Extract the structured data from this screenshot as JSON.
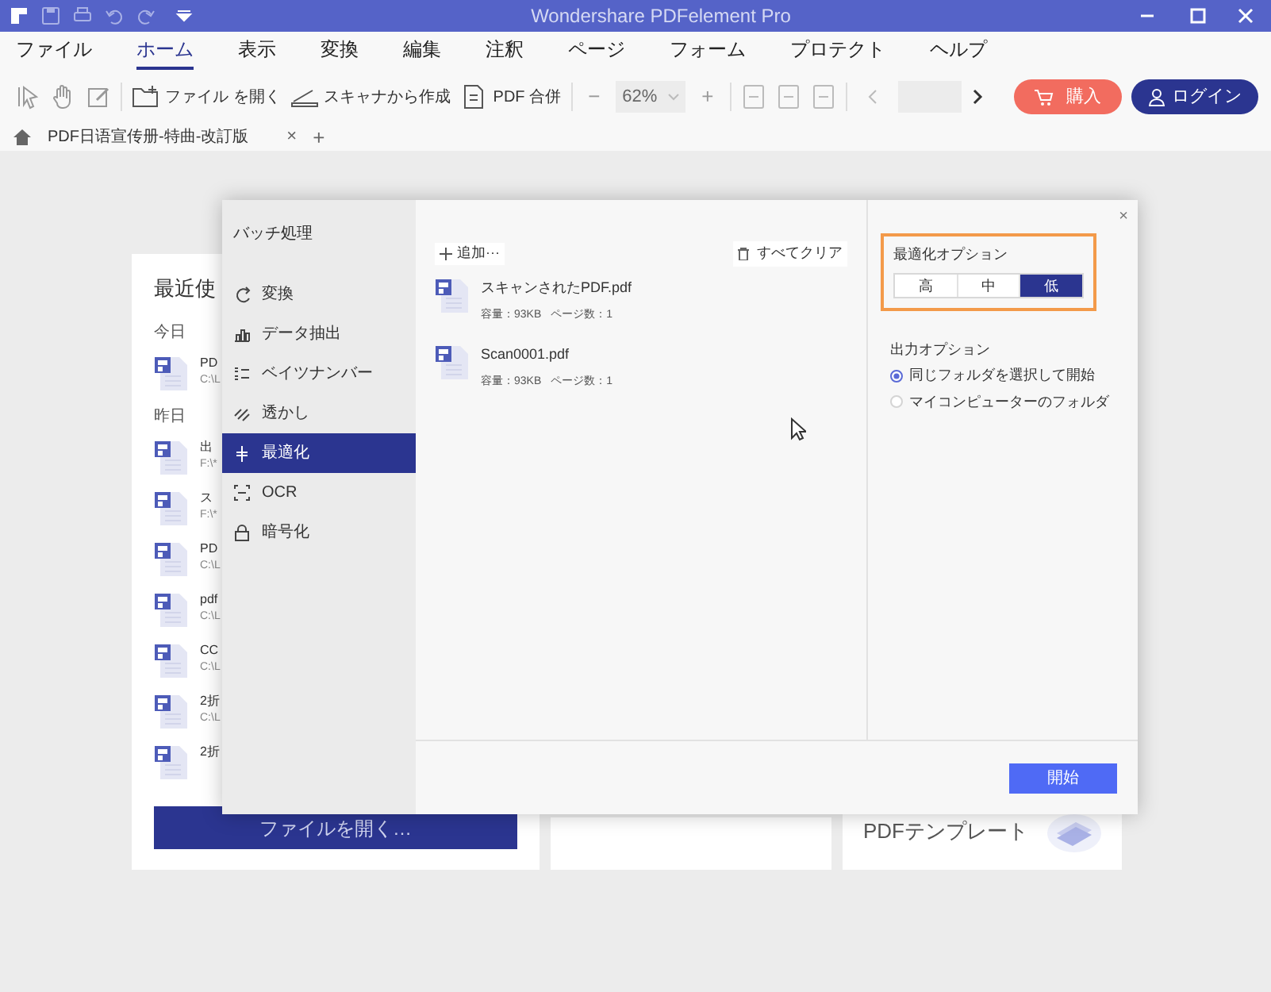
{
  "window": {
    "title": "Wondershare PDFelement Pro"
  },
  "menu": [
    {
      "label": "ファイル",
      "selected": false
    },
    {
      "label": "ホーム",
      "selected": true
    },
    {
      "label": "表示",
      "selected": false
    },
    {
      "label": "変換",
      "selected": false
    },
    {
      "label": "編集",
      "selected": false
    },
    {
      "label": "注釈",
      "selected": false
    },
    {
      "label": "ページ",
      "selected": false
    },
    {
      "label": "フォーム",
      "selected": false
    },
    {
      "label": "プロテクト",
      "selected": false
    },
    {
      "label": "ヘルプ",
      "selected": false
    }
  ],
  "toolbar": {
    "open_file": "ファイル を開く",
    "scan": "スキャナから作成",
    "merge": "PDF 合併",
    "zoom_out": "−",
    "zoom": "62%",
    "zoom_in": "+",
    "buy": "購入",
    "login": "ログイン"
  },
  "doc_tab": {
    "title": "PDF日语宣传册-特曲-改訂版",
    "close": "×",
    "add": "+"
  },
  "recent": {
    "title": "最近使",
    "groups": [
      {
        "label": "今日",
        "files": [
          {
            "name": "PD",
            "path": "C:\\L"
          }
        ]
      },
      {
        "label": "昨日",
        "files": [
          {
            "name": "出",
            "path": "F:\\*"
          },
          {
            "name": "ス",
            "path": "F:\\*"
          },
          {
            "name": "PD",
            "path": "C:\\L"
          },
          {
            "name": "pdf",
            "path": "C:\\L"
          },
          {
            "name": "CC",
            "path": "C:\\L"
          },
          {
            "name": "2折",
            "path": "C:\\L"
          },
          {
            "name": "2折"
          }
        ]
      }
    ],
    "open_button": "ファイルを開く…"
  },
  "template_card": {
    "title": "PDFテンプレート"
  },
  "dialog": {
    "title": "バッチ処理",
    "close": "×",
    "sidebar": [
      {
        "label": "変換",
        "kind": "convert",
        "selected": false
      },
      {
        "label": "データ抽出",
        "kind": "extract",
        "selected": false
      },
      {
        "label": "ベイツナンバー",
        "kind": "bates",
        "selected": false
      },
      {
        "label": "透かし",
        "kind": "watermark",
        "selected": false
      },
      {
        "label": "最適化",
        "kind": "optimize",
        "selected": true
      },
      {
        "label": "OCR",
        "kind": "ocr",
        "selected": false
      },
      {
        "label": "暗号化",
        "kind": "encrypt",
        "selected": false
      }
    ],
    "add": "追加···",
    "clear_all": "すべてクリア",
    "files": [
      {
        "name": "スキャンされたPDF.pdf",
        "size": "容量：93KB",
        "pages": "ページ数：1"
      },
      {
        "name": "Scan0001.pdf",
        "size": "容量：93KB",
        "pages": "ページ数：1"
      }
    ],
    "optimize_options": {
      "label": "最適化オプション",
      "levels": [
        {
          "label": "高",
          "selected": false
        },
        {
          "label": "中",
          "selected": false
        },
        {
          "label": "低",
          "selected": true
        }
      ]
    },
    "output_options": {
      "label": "出力オプション",
      "choices": [
        {
          "label": "同じフォルダを選択して開始",
          "selected": true
        },
        {
          "label": "マイコンピューターのフォルダ",
          "selected": false
        }
      ]
    },
    "start": "開始"
  }
}
